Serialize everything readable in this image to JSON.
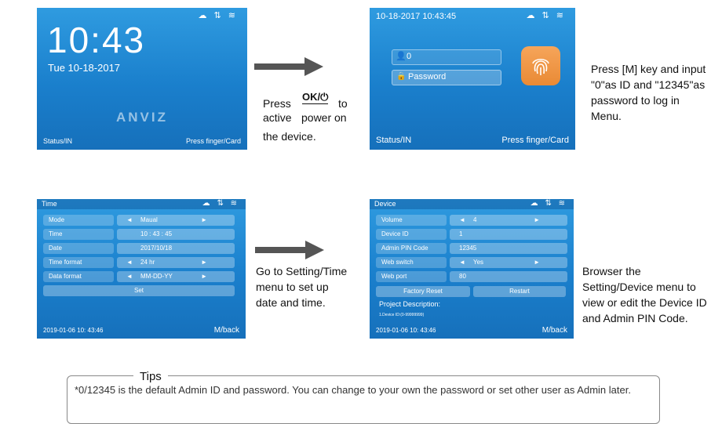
{
  "screen1": {
    "status_icons": "☁ ⇅ ≋",
    "time": "10:43",
    "date": "Tue 10-18-2017",
    "logo": "ANVIZ",
    "footer_left": "Status/IN",
    "footer_right": "Press finger/Card"
  },
  "screen2": {
    "top_time": "10-18-2017 10:43:45",
    "status_icons": "☁ ⇅ ≋",
    "id_value": "0",
    "password_label": "Password",
    "footer_left": "Status/IN",
    "footer_right": "Press finger/Card"
  },
  "step1": {
    "press": "Press",
    "key": "OK/⏻",
    "to": "to",
    "active": "active",
    "power_on": "power on",
    "device": "the device."
  },
  "step2_text": [
    "Press [M] key and input",
    "\"0\"as ID and \"12345\"as",
    "password to log in",
    "Menu."
  ],
  "screen3": {
    "title": "Time",
    "status_icons": "☁ ⇅ ≋",
    "rows": [
      {
        "label": "Mode",
        "left": "◄",
        "value": "Maual",
        "right": "►"
      },
      {
        "label": "Time",
        "left": "",
        "value": "10 : 43 : 45",
        "right": ""
      },
      {
        "label": "Date",
        "left": "",
        "value": "2017/10/18",
        "right": ""
      },
      {
        "label": "Time format",
        "left": "◄",
        "value": "24 hr",
        "right": "►"
      },
      {
        "label": "Data format",
        "left": "◄",
        "value": "MM-DD-YY",
        "right": "►"
      }
    ],
    "set_button": "Set",
    "footer_left": "2019-01-06 10: 43:46",
    "footer_right": "M/back"
  },
  "step3_text": [
    "Go to Setting/Time",
    "menu to set up",
    "date and time."
  ],
  "screen4": {
    "title": "Device",
    "status_icons": "☁ ⇅ ≋",
    "rows": [
      {
        "label": "Volume",
        "left": "◄",
        "value": "4",
        "right": "►"
      },
      {
        "label": "Device ID",
        "left": "",
        "value": "1",
        "right": ""
      },
      {
        "label": "Admin PIN Code",
        "left": "",
        "value": "12345",
        "right": ""
      },
      {
        "label": "Web switch",
        "left": "◄",
        "value": "Yes",
        "right": "►"
      },
      {
        "label": "Web port",
        "left": "",
        "value": "80",
        "right": ""
      }
    ],
    "factory_reset": "Factory Reset",
    "restart": "Restart",
    "project_description": "Project Description:",
    "project_detail": "1.Device ID:(0-99999999)",
    "footer_left": "2019-01-06 10: 43:46",
    "footer_right": "M/back"
  },
  "step4_text": [
    "Browser the",
    "Setting/Device menu to",
    "view or edit the Device ID",
    "and Admin PIN Code."
  ],
  "tips": {
    "title": "Tips",
    "text": "*0/12345 is the default Admin ID and password. You can change to your own the password or set other user as Admin later."
  }
}
